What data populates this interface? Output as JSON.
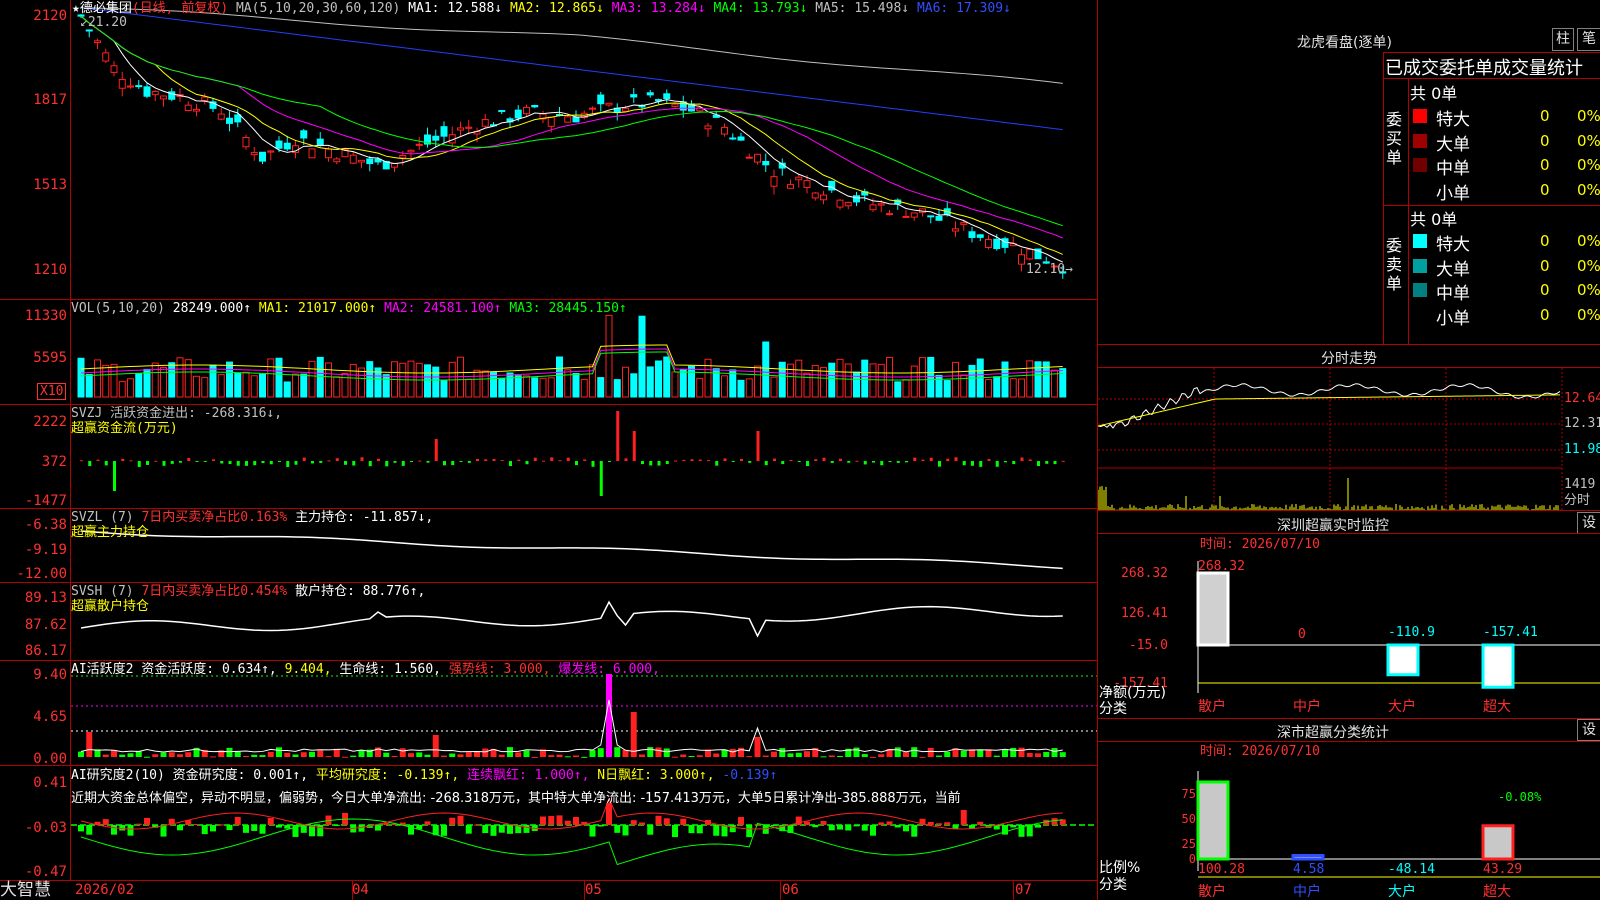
{
  "header": {
    "star": "★",
    "name": "德必集团",
    "period": "(日线, 前复权)",
    "ma_label": "MA(5,10,20,30,60,120)",
    "ma": [
      {
        "label": "MA1: 12.588↓",
        "color": "#ffffff"
      },
      {
        "label": "MA2: 12.865↓",
        "color": "#ffff00"
      },
      {
        "label": "MA3: 13.284↓",
        "color": "#ff00ff"
      },
      {
        "label": "MA4: 13.793↓",
        "color": "#00ff00"
      },
      {
        "label": "MA5: 15.498↓",
        "color": "#c0c0c0"
      },
      {
        "label": "MA6: 17.309↓",
        "color": "#0000ff"
      }
    ],
    "high_label": "21.20",
    "low_label": "12.10"
  },
  "price_axis": [
    "2120",
    "1817",
    "1513",
    "1210"
  ],
  "vol": {
    "label": "VOL(5,10,20)",
    "value": "28249.000↑",
    "ma1": "MA1: 21017.000↑",
    "ma2": "MA2: 24581.100↑",
    "ma3": "MA3: 28445.150↑",
    "axis": [
      "11330",
      "5595"
    ],
    "unit": "X10"
  },
  "svzj": {
    "label": "SVZJ  活跃资金进出: -268.316↓,",
    "sub": "超赢资金流(万元)",
    "axis": [
      "2222",
      "372",
      "-1477"
    ]
  },
  "svzl": {
    "label": "SVZL (7)",
    "ratio": "7日内买卖净占比0.163%",
    "hold": "主力持仓: -11.857↓,",
    "sub": "超赢主力持仓",
    "axis": [
      "-6.38",
      "-9.19",
      "-12.00"
    ]
  },
  "svsh": {
    "label": "SVSH (7)",
    "ratio": "7日内买卖净占比0.454%",
    "hold": "散户持仓: 88.776↑,",
    "sub": "超赢散户持仓",
    "axis": [
      "89.13",
      "87.62",
      "86.17"
    ]
  },
  "ai1": {
    "label": "AI活跃度2 资金活跃度: 0.634↑,",
    "v2": "9.404,",
    "life": "生命线: 1.560,",
    "strong": "强势线: 3.000,",
    "burst": "爆发线: 6.000,",
    "axis": [
      "9.40",
      "4.65",
      "0.00"
    ]
  },
  "ai2": {
    "label": "AI研究度2(10) 资金研究度: 0.001↑,",
    "avg": "平均研究度: -0.139↑,",
    "red": "连续飘红: 1.000↑,",
    "nred": "N日飘红: 3.000↑,",
    "last": "-0.139↑",
    "comment": "近期大资金总体偏空，异动不明显，偏弱势，今日大单净流出: -268.318万元，其中特大单净流出: -157.413万元，大单5日累计净出-385.888万元，当前",
    "axis": [
      "0.41",
      "-0.03",
      "-0.47"
    ]
  },
  "dates": [
    "2026/02",
    "04",
    "05",
    "06",
    "07"
  ],
  "brand": "大智慧",
  "right": {
    "dragon_title": "龙虎看盘(逐单)",
    "btn_bar": "柱",
    "btn_pen": "笔",
    "stats_title": "已成交委托单成交量统计",
    "buy_label": "委买单",
    "sell_label": "委卖单",
    "buy_total": "共 0单",
    "sell_total": "共 0单",
    "rows_buy": [
      {
        "name": "特大",
        "val": "0",
        "pct": "0%",
        "color": "#ff0000"
      },
      {
        "name": "大单",
        "val": "0",
        "pct": "0%",
        "color": "#a00000"
      },
      {
        "name": "中单",
        "val": "0",
        "pct": "0%",
        "color": "#700000"
      },
      {
        "name": "小单",
        "val": "0",
        "pct": "0%",
        "color": "#000000"
      }
    ],
    "rows_sell": [
      {
        "name": "特大",
        "val": "0",
        "pct": "0%",
        "color": "#00ffff"
      },
      {
        "name": "大单",
        "val": "0",
        "pct": "0%",
        "color": "#00a0a0"
      },
      {
        "name": "中单",
        "val": "0",
        "pct": "0%",
        "color": "#008080"
      },
      {
        "name": "小单",
        "val": "0",
        "pct": "0%",
        "color": "#000000"
      }
    ],
    "intraday_title": "分时走势",
    "intraday_axis": [
      "12.64",
      "12.31",
      "11.98",
      "1419"
    ],
    "intraday_unit": "分时",
    "monitor_title": "深圳超赢实时监控",
    "monitor_btn": "设",
    "monitor_time": "时间: 2026/07/10",
    "monitor_axis": [
      "268.32",
      "126.41",
      "-15.0",
      "-157.41"
    ],
    "monitor_values": [
      {
        "cat": "散户",
        "value": 268.32,
        "label": "268.32"
      },
      {
        "cat": "中户",
        "value": 0,
        "label": "0"
      },
      {
        "cat": "大户",
        "value": -110.9,
        "label": "-110.9"
      },
      {
        "cat": "超大",
        "value": -157.41,
        "label": "-157.41"
      }
    ],
    "monitor_ylabel": "净额(万元)",
    "monitor_xlabel": "分类",
    "class_title": "深市超赢分类统计",
    "class_btn": "设",
    "class_time": "时间: 2026/07/10",
    "class_axis": [
      "75",
      "50",
      "25",
      "0"
    ],
    "class_values": [
      {
        "cat": "散户",
        "value": 100.28,
        "label": "100.28"
      },
      {
        "cat": "中户",
        "value": 4.58,
        "label": "4.58"
      },
      {
        "cat": "大户",
        "value": -48.14,
        "label": "-48.14"
      },
      {
        "cat": "超大",
        "value": 43.29,
        "label": "43.29"
      }
    ],
    "class_extra": "-0.08%",
    "class_ylabel": "比例%",
    "class_xlabel": "分类"
  },
  "colors": {
    "up": "#ff2020",
    "down": "#00ffff",
    "grid": "#b00000",
    "axis": "#ff3030"
  }
}
